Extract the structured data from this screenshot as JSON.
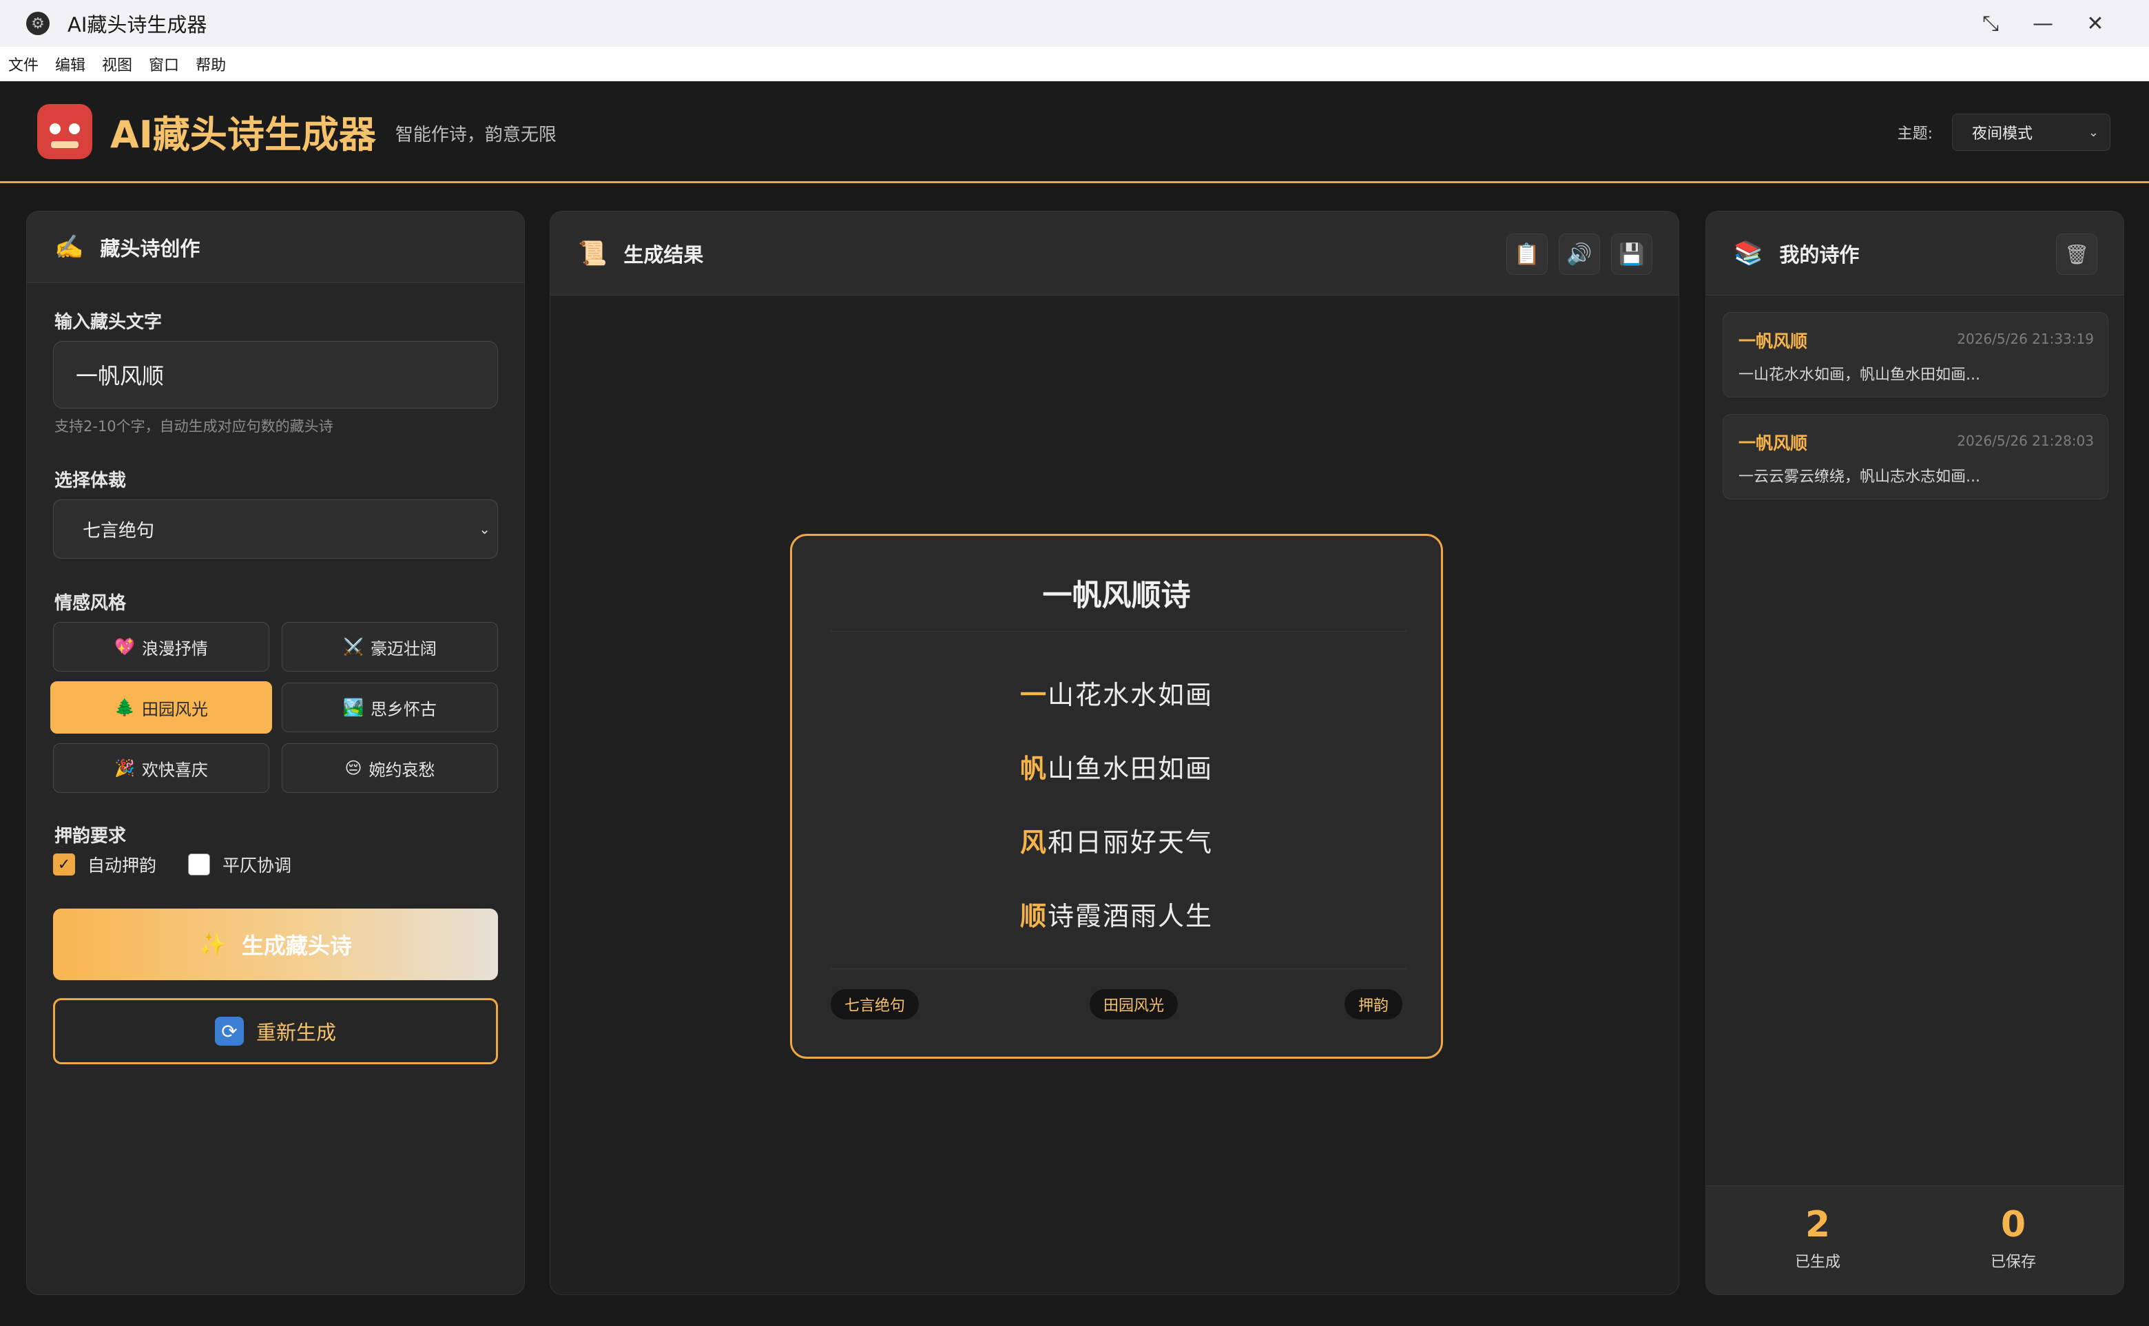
{
  "window": {
    "title": "AI藏头诗生成器",
    "icon": "app-icon"
  },
  "menu": [
    "文件",
    "编辑",
    "视图",
    "窗口",
    "帮助"
  ],
  "header": {
    "title": "AI藏头诗生成器",
    "subtitle": "智能作诗，韵意无限",
    "theme_label": "主题:",
    "theme_value": "夜间模式",
    "accent": "#f0a942"
  },
  "left": {
    "title": "藏头诗创作",
    "input_label": "输入藏头文字",
    "input_value": "一帆风顺",
    "input_hint": "支持2-10个字，自动生成对应句数的藏头诗",
    "genre_label": "选择体裁",
    "genre_value": "七言绝句",
    "style_label": "情感风格",
    "styles": [
      {
        "icon": "💖",
        "label": "浪漫抒情",
        "active": false
      },
      {
        "icon": "⚔️",
        "label": "豪迈壮阔",
        "active": false
      },
      {
        "icon": "🌲",
        "label": "田园风光",
        "active": true
      },
      {
        "icon": "🏞️",
        "label": "思乡怀古",
        "active": false
      },
      {
        "icon": "🎉",
        "label": "欢快喜庆",
        "active": false
      },
      {
        "icon": "😔",
        "label": "婉约哀愁",
        "active": false
      }
    ],
    "rhyme_label": "押韵要求",
    "rhyme_auto": "自动押韵",
    "rhyme_tone": "平仄协调",
    "generate": "生成藏头诗",
    "regenerate": "重新生成"
  },
  "center": {
    "title": "生成结果",
    "poem": {
      "title": "一帆风顺诗",
      "lines": [
        {
          "head": "一",
          "rest": "山花水水如画"
        },
        {
          "head": "帆",
          "rest": "山鱼水田如画"
        },
        {
          "head": "风",
          "rest": "和日丽好天气"
        },
        {
          "head": "顺",
          "rest": "诗霞酒雨人生"
        }
      ],
      "tags": [
        "七言绝句",
        "田园风光",
        "押韵"
      ]
    }
  },
  "right": {
    "title": "我的诗作",
    "history": [
      {
        "title": "一帆风顺",
        "time": "2026/5/26 21:33:19",
        "preview": "一山花水水如画，帆山鱼水田如画..."
      },
      {
        "title": "一帆风顺",
        "time": "2026/5/26 21:28:03",
        "preview": "一云云雾云缭绕，帆山志水志如画..."
      }
    ],
    "stats": [
      {
        "num": "2",
        "label": "已生成"
      },
      {
        "num": "0",
        "label": "已保存"
      }
    ]
  }
}
